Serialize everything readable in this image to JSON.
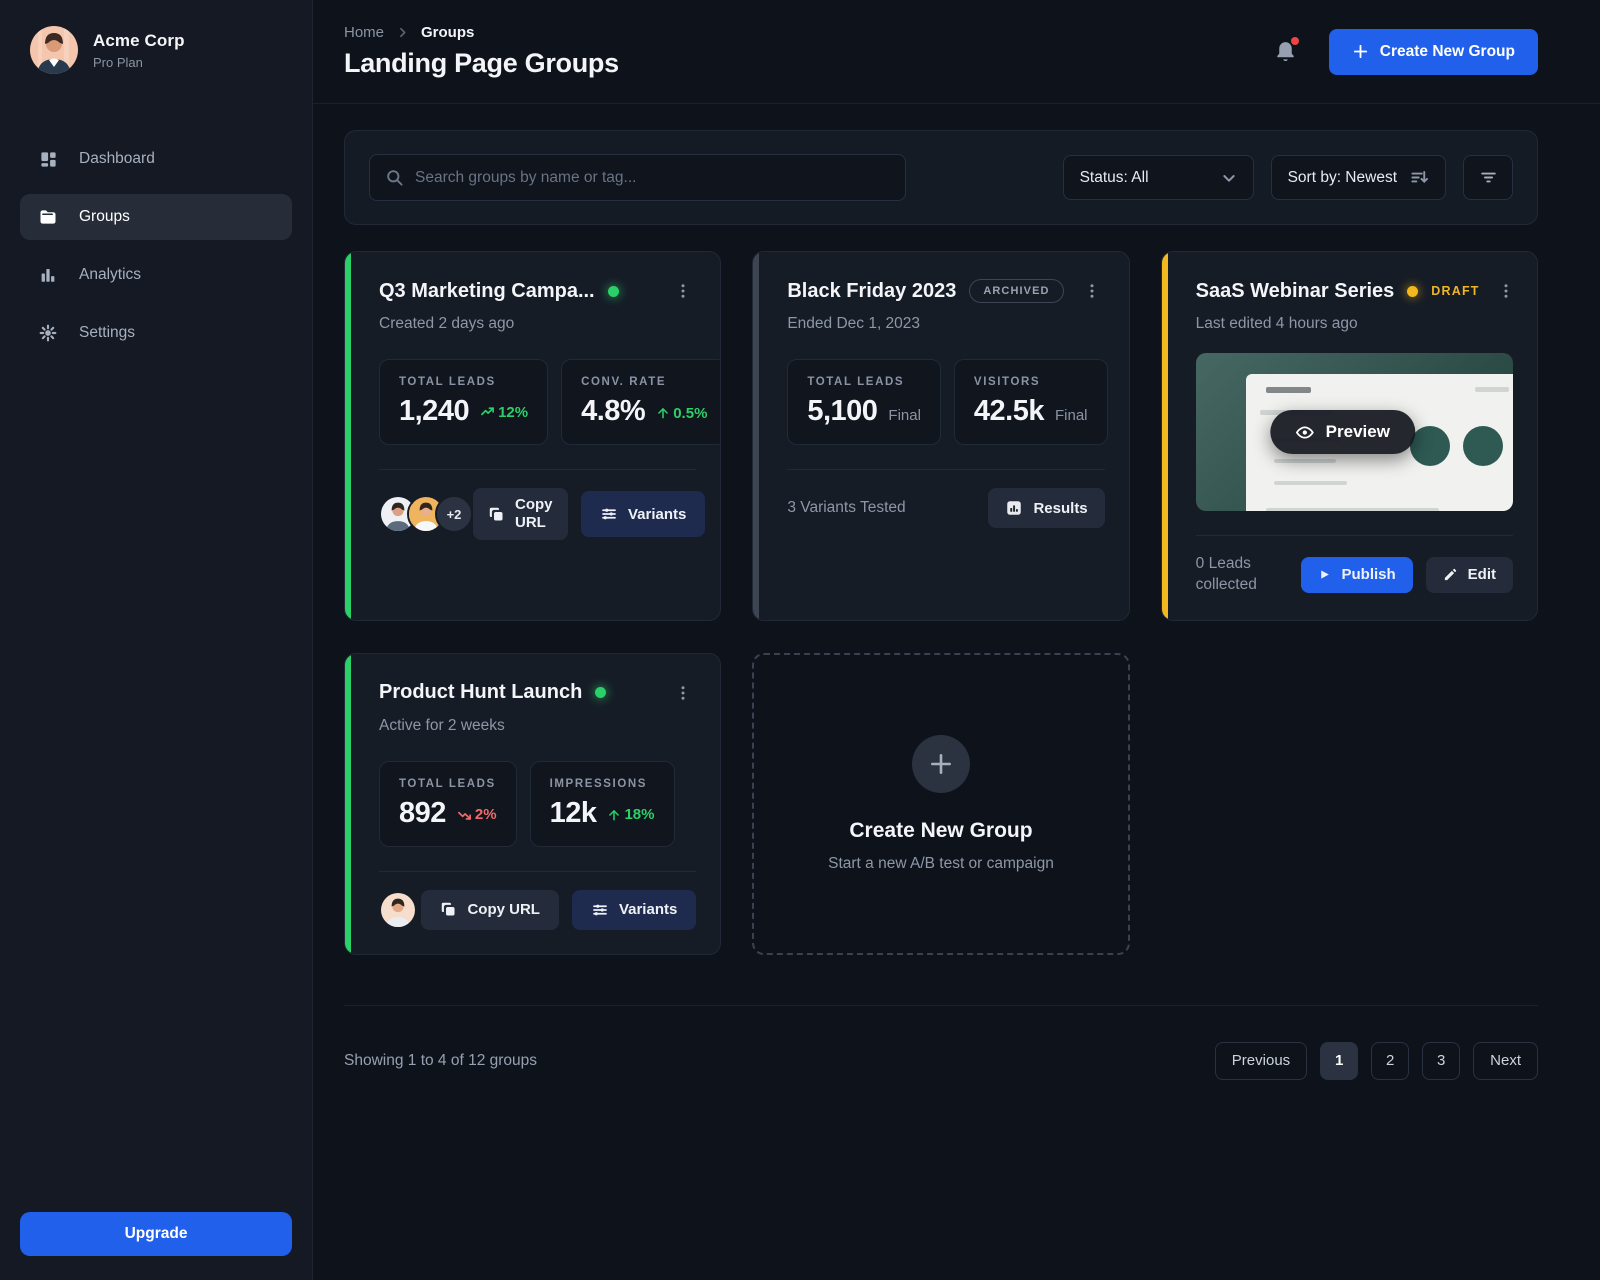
{
  "sidebar": {
    "org": {
      "name": "Acme Corp",
      "plan": "Pro Plan"
    },
    "items": [
      {
        "label": "Dashboard",
        "active": false
      },
      {
        "label": "Groups",
        "active": true
      },
      {
        "label": "Analytics",
        "active": false
      },
      {
        "label": "Settings",
        "active": false
      }
    ],
    "upgrade_label": "Upgrade"
  },
  "header": {
    "breadcrumb": [
      "Home",
      "Groups"
    ],
    "title": "Landing Page Groups",
    "create_button": "Create New Group"
  },
  "filters": {
    "search_placeholder": "Search groups by name or tag...",
    "status_label": "Status: All",
    "sort_label": "Sort by: Newest"
  },
  "cards": [
    {
      "title": "Q3 Marketing Campa...",
      "status": "active",
      "meta": "Created 2 days ago",
      "stats": [
        {
          "label": "TOTAL LEADS",
          "value": "1,240",
          "delta": "12%",
          "trend": "up"
        },
        {
          "label": "CONV. RATE",
          "value": "4.8%",
          "delta": "0.5%",
          "trend": "up"
        }
      ],
      "avatars_extra": "+2",
      "copy_url_label": "Copy URL",
      "variants_label": "Variants"
    },
    {
      "title": "Black Friday 2023",
      "badge": "ARCHIVED",
      "meta": "Ended Dec 1, 2023",
      "stats": [
        {
          "label": "TOTAL LEADS",
          "value": "5,100",
          "suffix": "Final"
        },
        {
          "label": "VISITORS",
          "value": "42.5k",
          "suffix": "Final"
        }
      ],
      "footer_note": "3 Variants Tested",
      "results_label": "Results"
    },
    {
      "title": "SaaS Webinar Series",
      "badge": "DRAFT",
      "status": "draft",
      "meta": "Last edited 4 hours ago",
      "preview_label": "Preview",
      "footer_note": "0 Leads collected",
      "publish_label": "Publish",
      "edit_label": "Edit"
    },
    {
      "title": "Product Hunt Launch",
      "status": "active",
      "meta": "Active for 2 weeks",
      "stats": [
        {
          "label": "TOTAL LEADS",
          "value": "892",
          "delta": "2%",
          "trend": "down"
        },
        {
          "label": "IMPRESSIONS",
          "value": "12k",
          "delta": "18%",
          "trend": "up"
        }
      ],
      "copy_url_label": "Copy URL",
      "variants_label": "Variants"
    }
  ],
  "create_card": {
    "title": "Create New Group",
    "subtitle": "Start a new A/B test or campaign"
  },
  "pagination": {
    "summary": "Showing 1 to 4 of 12 groups",
    "prev": "Previous",
    "pages": [
      "1",
      "2",
      "3"
    ],
    "active_page": "1",
    "next": "Next"
  },
  "colors": {
    "accent_blue": "#2160ea",
    "green": "#2ad168",
    "yellow": "#f3b71f",
    "red": "#ef6b6b",
    "navy": "#1e2b4f"
  }
}
